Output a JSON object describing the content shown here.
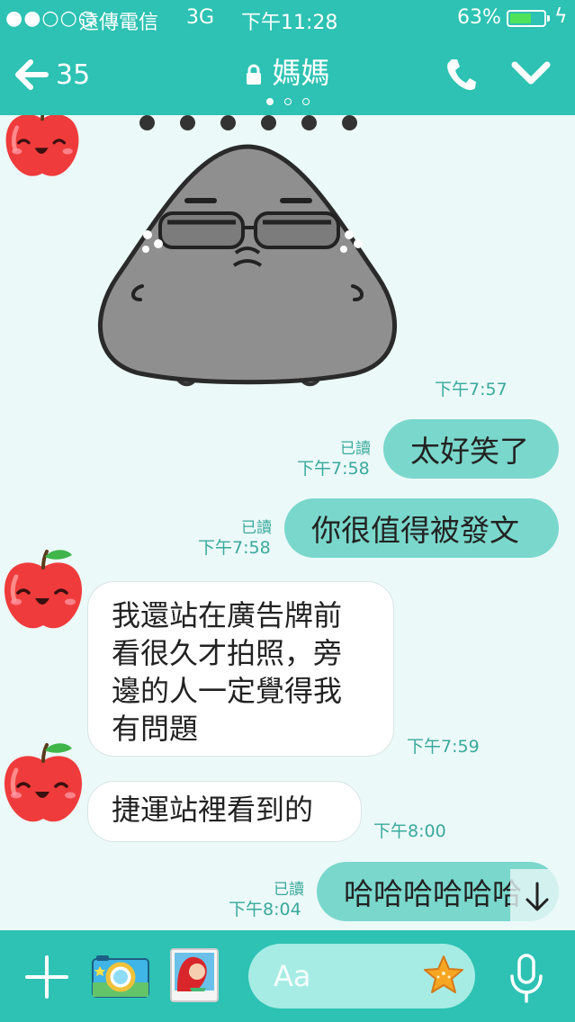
{
  "status_bar": {
    "signal": "●●○○○",
    "carrier": "遠傳電信",
    "network": "3G",
    "clock": "下午11:28",
    "battery_percent": "63%",
    "battery_level": 0.63
  },
  "header": {
    "unread_count": "35",
    "title": "媽媽",
    "page_count": 3,
    "active_page": 1
  },
  "messages": [
    {
      "id": "m1",
      "direction": "in",
      "type": "sticker",
      "sticker": "grumpy-gray-blob-with-glasses",
      "time": "下午7:57"
    },
    {
      "id": "m2",
      "direction": "out",
      "text": "太好笑了",
      "read": "已讀",
      "time": "下午7:58"
    },
    {
      "id": "m3",
      "direction": "out",
      "text": "你很值得被發文",
      "read": "已讀",
      "time": "下午7:58"
    },
    {
      "id": "m4",
      "direction": "in",
      "lines": [
        "我還站在廣告牌前",
        "看很久才拍照，旁",
        "邊的人一定覺得我",
        "有問題"
      ],
      "time": "下午7:59"
    },
    {
      "id": "m5",
      "direction": "in",
      "text": "捷運站裡看到的",
      "time": "下午8:00"
    },
    {
      "id": "m6",
      "direction": "out",
      "text": "哈哈哈哈哈哈",
      "read": "已讀",
      "time": "下午8:04"
    }
  ],
  "input": {
    "placeholder": "Aa"
  },
  "icons": {
    "back": "back-arrow-icon",
    "lock": "lock-icon",
    "call": "phone-icon",
    "menu": "chevron-down-icon",
    "plus": "plus-icon",
    "camera": "camera-icon",
    "gallery": "gallery-icon",
    "sticker": "starfish-sticker-icon",
    "mic": "microphone-icon",
    "scroll": "arrow-down-icon"
  },
  "colors": {
    "accent": "#2dc2b3",
    "background": "#ebf9f8",
    "bubble_out": "#7ad7cc",
    "bubble_in": "#ffffff",
    "time_text": "#3aa99c"
  }
}
